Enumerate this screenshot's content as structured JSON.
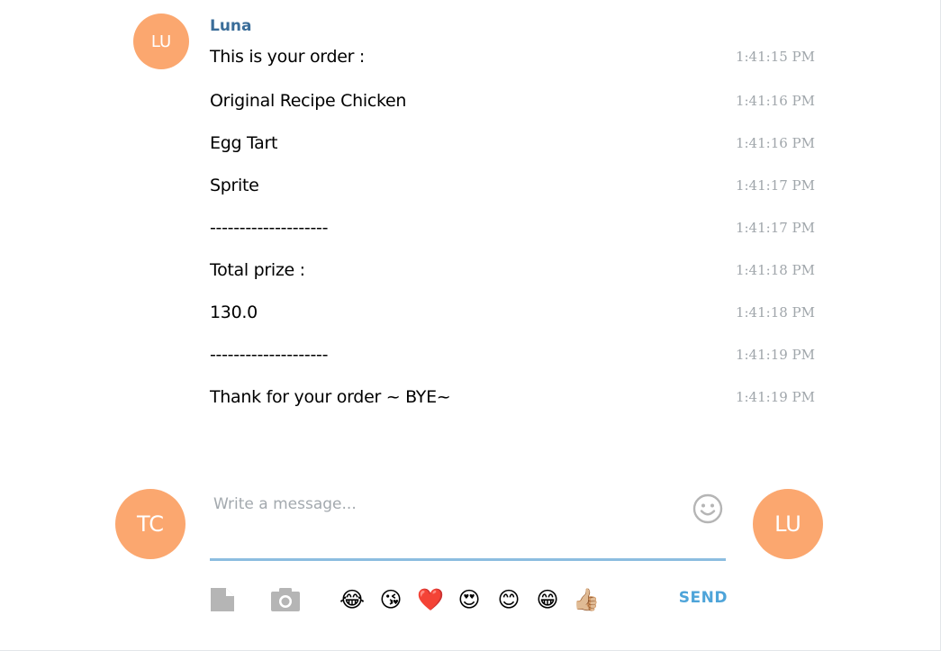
{
  "conversation": {
    "sender_name": "Luna",
    "sender_initials": "LU",
    "messages": [
      {
        "text": "This is your order :",
        "time": "1:41:15 PM"
      },
      {
        "text": "Original Recipe Chicken",
        "time": "1:41:16 PM"
      },
      {
        "text": "Egg Tart",
        "time": "1:41:16 PM"
      },
      {
        "text": "Sprite",
        "time": "1:41:17 PM"
      },
      {
        "text": "--------------------",
        "time": "1:41:17 PM"
      },
      {
        "text": "Total prize :",
        "time": "1:41:18 PM"
      },
      {
        "text": "130.0",
        "time": "1:41:18 PM"
      },
      {
        "text": "--------------------",
        "time": "1:41:19 PM"
      },
      {
        "text": "Thank for your order ~ BYE~",
        "time": "1:41:19 PM"
      }
    ]
  },
  "composer": {
    "my_initials": "TC",
    "peer_initials": "LU",
    "placeholder": "Write a message...",
    "value": "",
    "send_label": "SEND",
    "emoji_icons": [
      "joy-emoji-icon",
      "kissing-heart-emoji-icon",
      "heart-emoji-icon",
      "heart-eyes-emoji-icon",
      "blush-emoji-icon",
      "grin-emoji-icon",
      "thumbs-up-emoji-icon"
    ],
    "emojis": [
      "😂",
      "😘",
      "❤️",
      "😍",
      "😊",
      "😁",
      "👍🏼"
    ]
  },
  "colors": {
    "avatar": "#fba76f",
    "sender_name": "#3a6d99",
    "timestamp": "#a0a6ab",
    "input_underline": "#8cbde0",
    "send": "#4ea4d9",
    "tool_icon": "#b5b5b5"
  }
}
